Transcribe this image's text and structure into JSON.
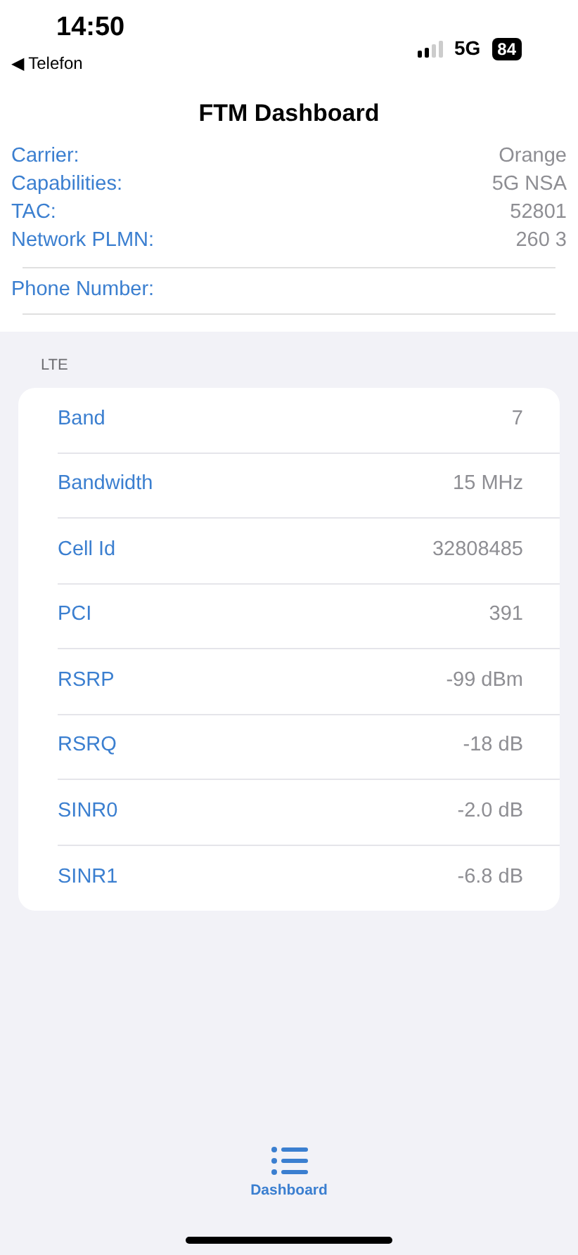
{
  "status_bar": {
    "time": "14:50",
    "back_link": "◀ Telefon",
    "network": "5G",
    "battery": "84"
  },
  "title": "FTM Dashboard",
  "info": [
    {
      "label": "Carrier:",
      "value": "Orange"
    },
    {
      "label": "Capabilities:",
      "value": "5G NSA"
    },
    {
      "label": "TAC:",
      "value": "52801"
    },
    {
      "label": "Network PLMN:",
      "value": "260 3"
    }
  ],
  "phone_number": {
    "label": "Phone Number:"
  },
  "lte": {
    "header": "LTE",
    "rows": [
      {
        "label": "Band",
        "value": "7"
      },
      {
        "label": "Bandwidth",
        "value": "15 MHz"
      },
      {
        "label": "Cell Id",
        "value": "32808485"
      },
      {
        "label": "PCI",
        "value": "391"
      },
      {
        "label": "RSRP",
        "value": "-99 dBm"
      },
      {
        "label": "RSRQ",
        "value": "-18 dB"
      },
      {
        "label": "SINR0",
        "value": "-2.0 dB"
      },
      {
        "label": "SINR1",
        "value": "-6.8 dB"
      }
    ]
  },
  "tab_bar": [
    {
      "label": "Dashboard",
      "selected": true
    }
  ]
}
